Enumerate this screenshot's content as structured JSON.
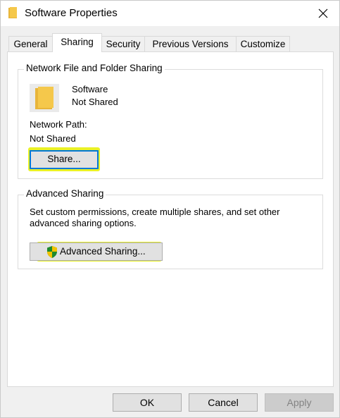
{
  "window": {
    "title": "Software Properties"
  },
  "tabs": [
    {
      "label": "General"
    },
    {
      "label": "Sharing"
    },
    {
      "label": "Security"
    },
    {
      "label": "Previous Versions"
    },
    {
      "label": "Customize"
    }
  ],
  "active_tab": "Sharing",
  "network_sharing": {
    "group_label": "Network File and Folder Sharing",
    "folder_name": "Software",
    "status": "Not Shared",
    "path_label": "Network Path:",
    "path_value": "Not Shared",
    "share_button": "Share..."
  },
  "advanced_sharing": {
    "group_label": "Advanced Sharing",
    "description": "Set custom permissions, create multiple shares, and set other advanced sharing options.",
    "description_line1": "Set custom permissions, create multiple shares, and set other",
    "description_line2": "advanced sharing options.",
    "button": "Advanced Sharing..."
  },
  "footer": {
    "ok": "OK",
    "cancel": "Cancel",
    "apply": "Apply"
  },
  "colors": {
    "highlight": "#e6f000",
    "focus_border": "#0078d7",
    "folder": "#f5c84b"
  }
}
